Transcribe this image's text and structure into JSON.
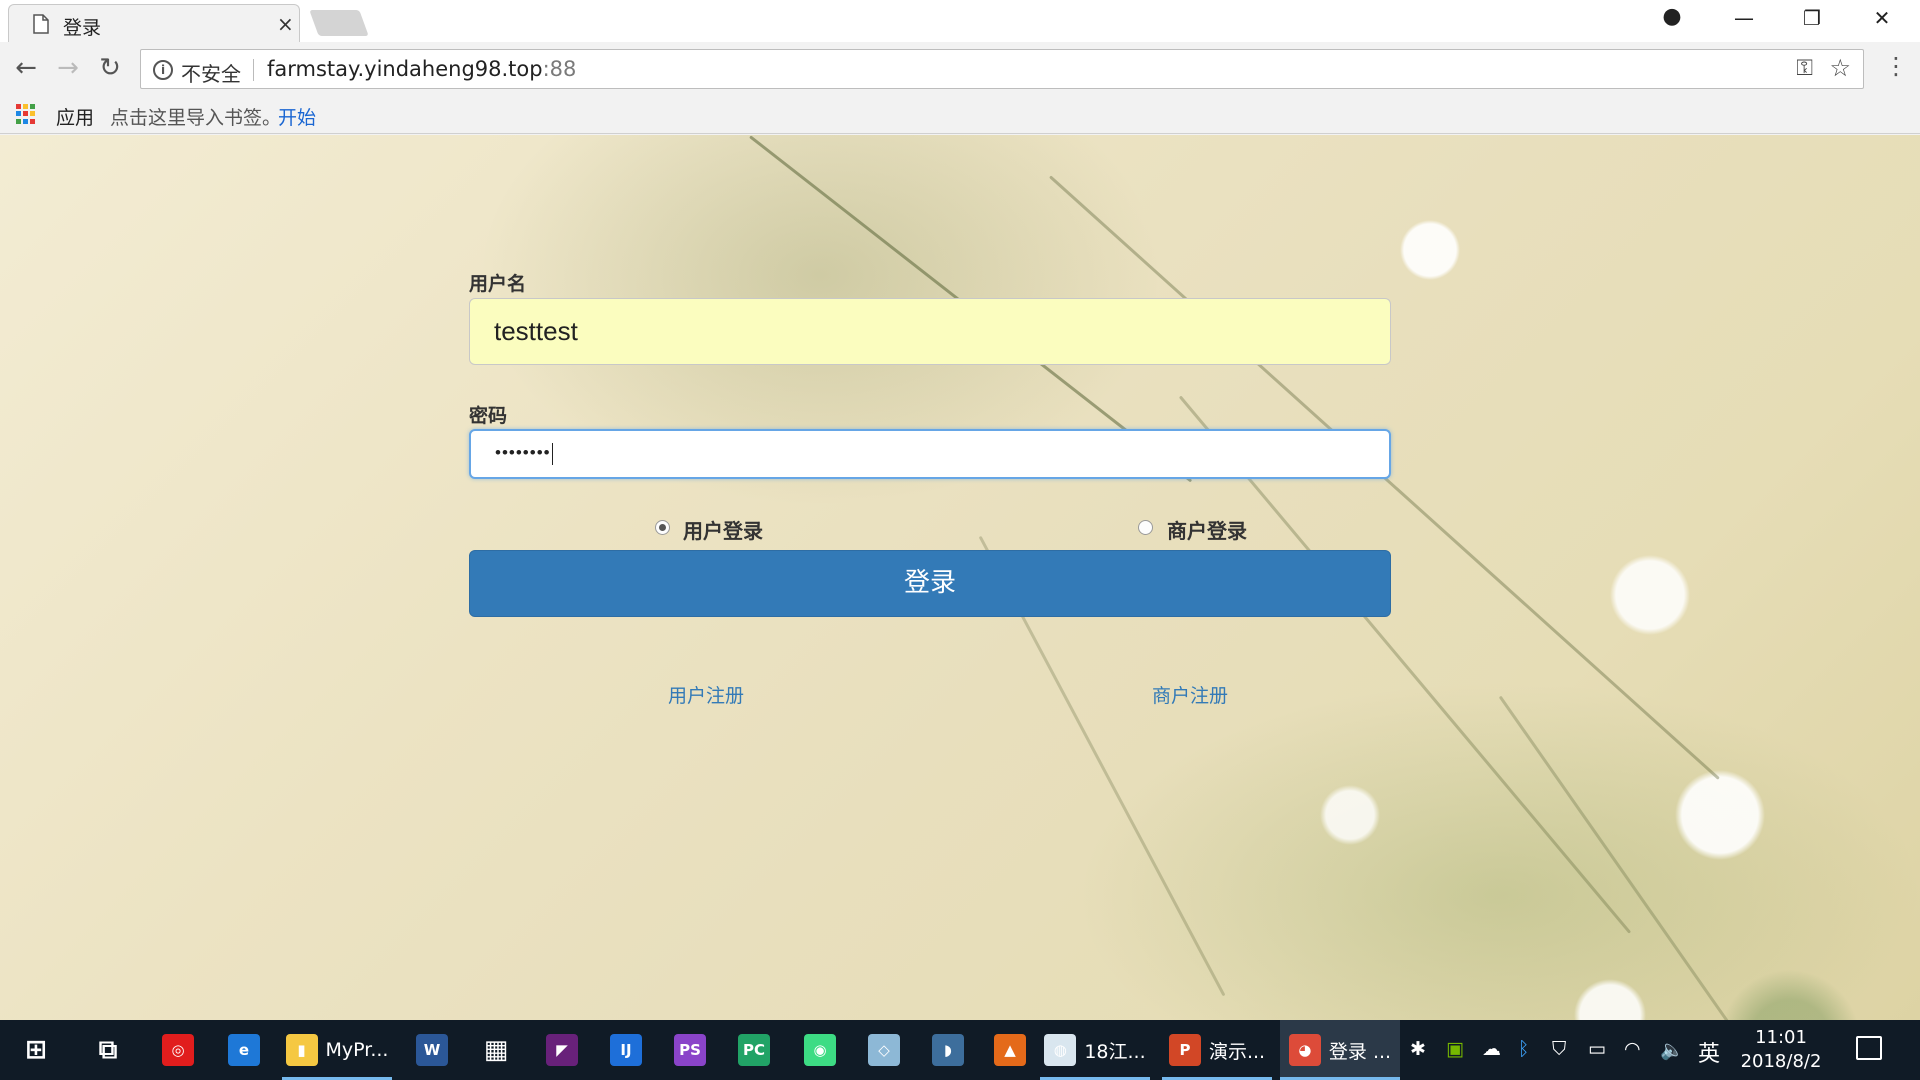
{
  "browser": {
    "tab_title": "登录",
    "tab_close": "×",
    "window_controls": {
      "minimize": "—",
      "restore": "❐",
      "close": "✕"
    },
    "profile_icon": "●",
    "security_label": "不安全",
    "url_host": "farmstay.yindaheng98.top",
    "url_port": ":88",
    "nav": {
      "back": "←",
      "forward": "→",
      "reload": "↻"
    },
    "bookmarks": {
      "apps_label": "应用",
      "hint": "点击这里导入书签。",
      "start_link": "开始"
    }
  },
  "login": {
    "username_label": "用户名",
    "username_value": "testtest",
    "password_label": "密码",
    "password_mask": "••••••••",
    "role_user_label": "用户登录",
    "role_merchant_label": "商户登录",
    "selected_role": "user",
    "submit_label": "登录",
    "register_user_link": "用户注册",
    "register_merchant_link": "商户注册",
    "colors": {
      "button": "#337ab7",
      "link": "#337ab7",
      "autofill": "#fbfdbf"
    }
  },
  "taskbar": {
    "apps": [
      {
        "name": "windows-start",
        "glyph": "⊞",
        "color": "transparent"
      },
      {
        "name": "task-view",
        "glyph": "⧉",
        "color": "transparent"
      },
      {
        "name": "netease-music",
        "glyph": "◎",
        "color": "#e11d1d"
      },
      {
        "name": "edge",
        "glyph": "e",
        "color": "#1e78d7"
      },
      {
        "name": "file-explorer",
        "glyph": "▮",
        "color": "#f5c842",
        "label": "MyPr..."
      },
      {
        "name": "word",
        "glyph": "W",
        "color": "#2b5797"
      },
      {
        "name": "calculator",
        "glyph": "▦",
        "color": "transparent"
      },
      {
        "name": "visual-studio",
        "glyph": "◤",
        "color": "#68217a"
      },
      {
        "name": "intellij",
        "glyph": "IJ",
        "color": "#1e6fd9"
      },
      {
        "name": "phpstorm",
        "glyph": "PS",
        "color": "#8a44c9"
      },
      {
        "name": "pycharm",
        "glyph": "PC",
        "color": "#21a366"
      },
      {
        "name": "android-studio",
        "glyph": "◉",
        "color": "#3ddc84"
      },
      {
        "name": "notepad-app",
        "glyph": "◇",
        "color": "#8db8d6"
      },
      {
        "name": "mysql-workbench",
        "glyph": "◗",
        "color": "#3d6e9c"
      },
      {
        "name": "matlab",
        "glyph": "▲",
        "color": "#e46a1a"
      },
      {
        "name": "school-app",
        "glyph": "◍",
        "color": "#d9e6ef",
        "label": "18江..."
      },
      {
        "name": "powerpoint",
        "glyph": "P",
        "color": "#d24726",
        "label": "演示..."
      },
      {
        "name": "chrome",
        "glyph": "◕",
        "color": "#dd4b39",
        "label": "登录 ..."
      }
    ],
    "ime": "英",
    "time": "11:01",
    "date": "2018/8/2"
  }
}
